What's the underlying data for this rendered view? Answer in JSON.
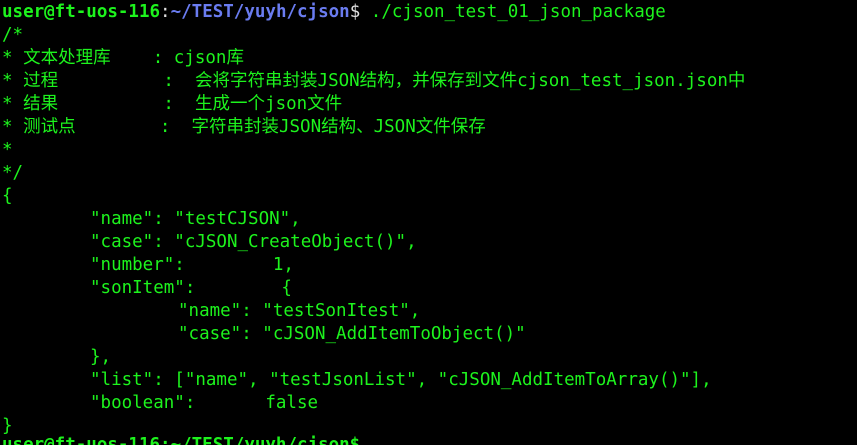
{
  "prompt": {
    "user_host": "user@ft-uos-116",
    "colon": ":",
    "path": "~/TEST/yuyh/cjson",
    "dollar": "$",
    "command": " ./cjson_test_01_json_package"
  },
  "header_comment": [
    "/*",
    "* 文本处理库    : cjson库",
    "* 过程          :  会将字符串封装JSON结构，并保存到文件cjson_test_json.json中",
    "* 结果          :  生成一个json文件",
    "* 测试点        :  字符串封装JSON结构、JSON文件保存",
    "*",
    "*/"
  ],
  "json_output": {
    "open_brace": "{",
    "name_line": "\"name\": \"testCJSON\",",
    "case_line": "\"case\": \"cJSON_CreateObject()\",",
    "number_key": "\"number\":",
    "number_value": "1,",
    "sonitem_key": "\"sonItem\":",
    "sonitem_open": "{",
    "son_name_line": "\"name\": \"testSonItest\",",
    "son_case_line": "\"case\": \"cJSON_AddItemToObject()\"",
    "sonitem_close": "},",
    "list_line": "\"list\": [\"name\", \"testJsonList\", \"cJSON_AddItemToArray()\"],",
    "boolean_key": "\"boolean\":",
    "boolean_value": "false",
    "close_brace": "}"
  },
  "next_prompt_partial": "user@ft-uos-116:~/TEST/yuyh/cjson$"
}
